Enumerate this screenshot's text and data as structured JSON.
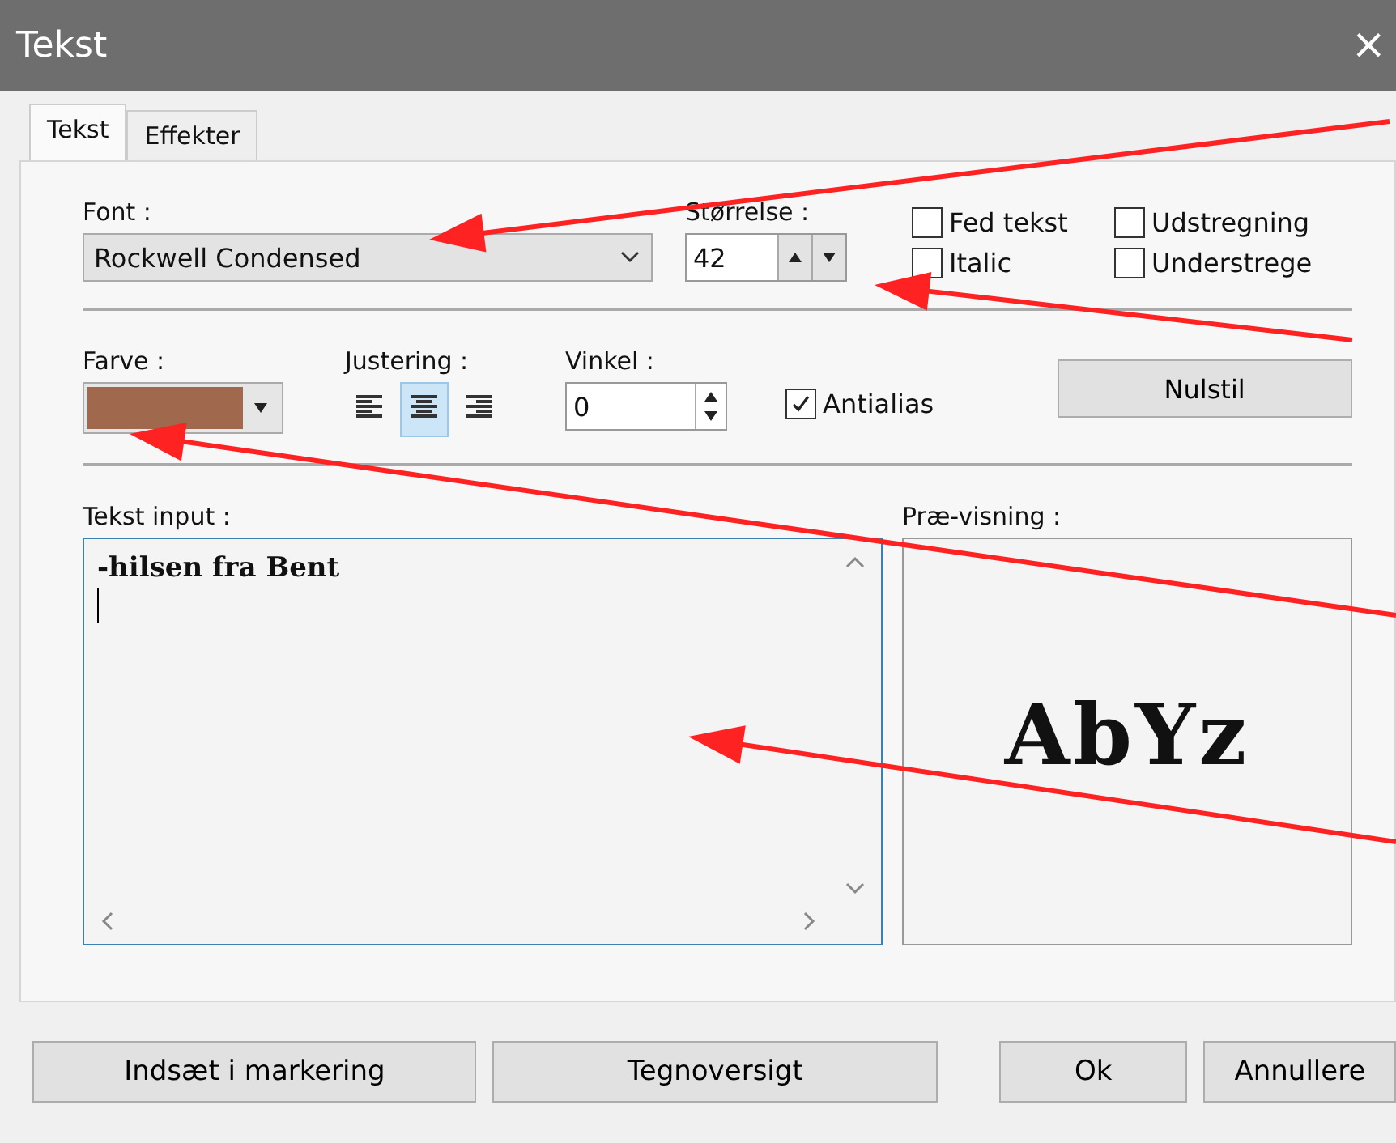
{
  "window": {
    "title": "Tekst",
    "close": "×"
  },
  "tabs": [
    {
      "label": "Tekst",
      "selected": true
    },
    {
      "label": "Effekter",
      "selected": false
    }
  ],
  "font": {
    "label": "Font :",
    "value": "Rockwell Condensed"
  },
  "size": {
    "label": "Størrelse :",
    "value": "42"
  },
  "styles": [
    {
      "label": "Fed tekst",
      "checked": false
    },
    {
      "label": "Udstregning",
      "checked": false
    },
    {
      "label": "Italic",
      "checked": false
    },
    {
      "label": "Understrege",
      "checked": false
    }
  ],
  "color": {
    "label": "Farve :",
    "color": "#a0684c"
  },
  "alignment": {
    "label": "Justering :",
    "options": [
      {
        "kind": "left",
        "selected": false
      },
      {
        "kind": "center",
        "selected": true
      },
      {
        "kind": "right",
        "selected": false
      }
    ]
  },
  "angle": {
    "label": "Vinkel :",
    "value": "0"
  },
  "antialias": {
    "label": "Antialias",
    "checked": true
  },
  "reset_button": "Nulstil",
  "text_input": {
    "label": "Tekst input :",
    "value": "-hilsen fra Bent"
  },
  "preview": {
    "label": "Præ-visning :",
    "sample": "AbYz"
  },
  "buttons": [
    "Indsæt i markering",
    "Tegnoversigt",
    "Ok",
    "Annullere"
  ]
}
